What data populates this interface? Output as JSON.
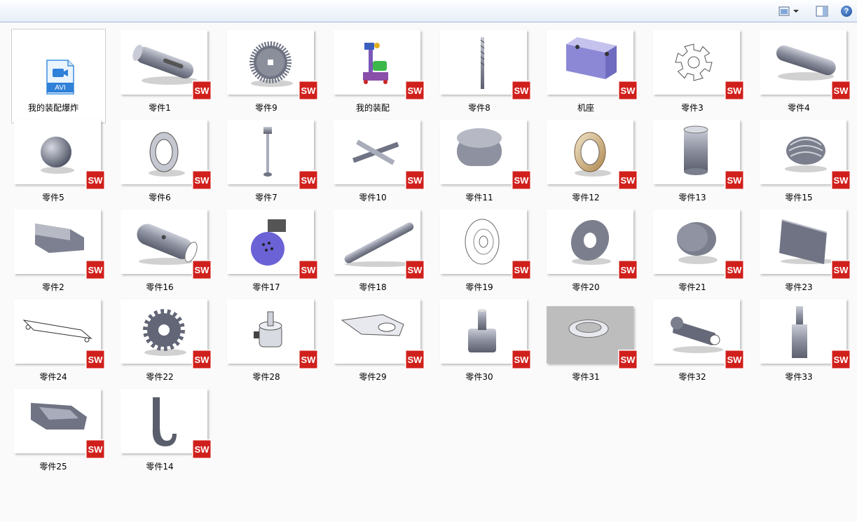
{
  "toolbar": {
    "view_icon": "change-view-icon",
    "pane_icon": "preview-pane-icon",
    "help_label": "?"
  },
  "video_file": {
    "name": "我的装配爆炸",
    "type_label": "AVI"
  },
  "files": [
    {
      "name": "零件1",
      "icon": "shaft-part"
    },
    {
      "name": "零件9",
      "icon": "gear-part"
    },
    {
      "name": "我的装配",
      "icon": "assembly"
    },
    {
      "name": "零件8",
      "icon": "screw-rod"
    },
    {
      "name": "机座",
      "icon": "base-frame"
    },
    {
      "name": "零件3",
      "icon": "star-wheel"
    },
    {
      "name": "零件4",
      "icon": "key-bar"
    },
    {
      "name": "零件5",
      "icon": "ball"
    },
    {
      "name": "零件6",
      "icon": "bearing"
    },
    {
      "name": "零件7",
      "icon": "post"
    },
    {
      "name": "零件10",
      "icon": "cross"
    },
    {
      "name": "零件11",
      "icon": "oval-block"
    },
    {
      "name": "零件12",
      "icon": "bearing-gold"
    },
    {
      "name": "零件13",
      "icon": "sleeve"
    },
    {
      "name": "零件15",
      "icon": "bellows"
    },
    {
      "name": "零件2",
      "icon": "housing"
    },
    {
      "name": "零件16",
      "icon": "tube"
    },
    {
      "name": "零件17",
      "icon": "motor"
    },
    {
      "name": "零件18",
      "icon": "rod"
    },
    {
      "name": "零件19",
      "icon": "pulley"
    },
    {
      "name": "零件20",
      "icon": "washer"
    },
    {
      "name": "零件21",
      "icon": "disc"
    },
    {
      "name": "零件23",
      "icon": "plate"
    },
    {
      "name": "零件24",
      "icon": "board"
    },
    {
      "name": "零件22",
      "icon": "spur-gear"
    },
    {
      "name": "零件28",
      "icon": "servo"
    },
    {
      "name": "零件29",
      "icon": "tab-plate"
    },
    {
      "name": "零件30",
      "icon": "stepped-shaft"
    },
    {
      "name": "零件31",
      "icon": "ring-gear"
    },
    {
      "name": "零件32",
      "icon": "arm"
    },
    {
      "name": "零件33",
      "icon": "pin"
    },
    {
      "name": "零件25",
      "icon": "tray"
    },
    {
      "name": "零件14",
      "icon": "hook"
    }
  ],
  "badge": {
    "label": "SW",
    "color": "#d0201c"
  }
}
